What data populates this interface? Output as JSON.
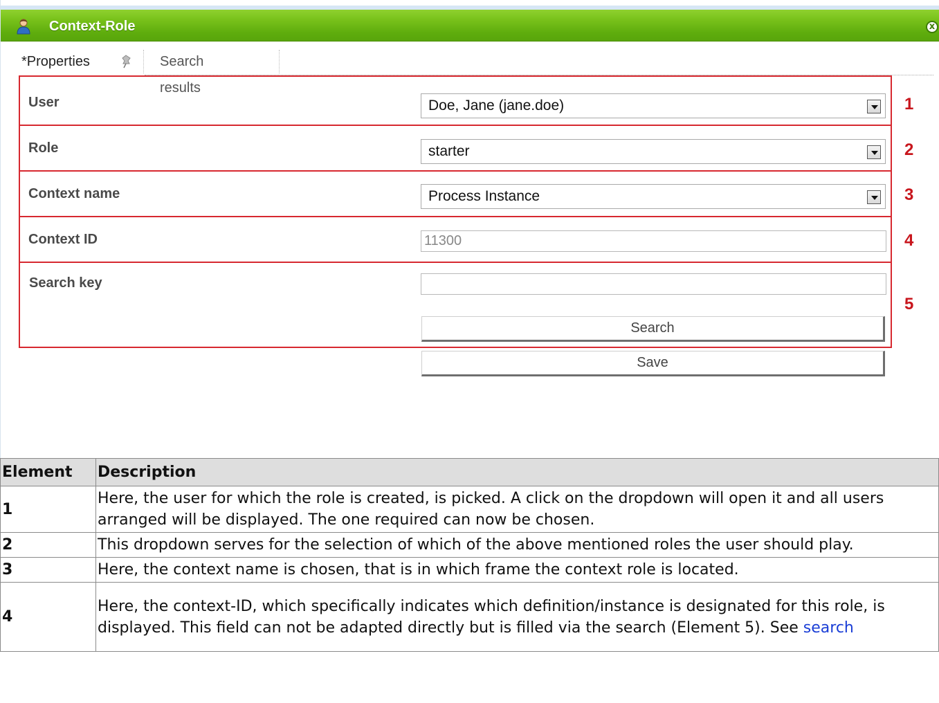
{
  "window": {
    "title": "Context-Role",
    "close_symbol": "x",
    "icon": "user-icon"
  },
  "tabs": [
    {
      "label": "*Properties",
      "icon": "pin-icon",
      "active": true
    },
    {
      "label": "Search results",
      "active": false
    }
  ],
  "form": {
    "user": {
      "label": "User",
      "value": "Doe, Jane (jane.doe)",
      "marker": "1"
    },
    "role": {
      "label": "Role",
      "value": "starter",
      "marker": "2"
    },
    "context_name": {
      "label": "Context name",
      "value": "Process Instance",
      "marker": "3"
    },
    "context_id": {
      "label": "Context ID",
      "value": "11300",
      "marker": "4"
    },
    "search_key": {
      "label": "Search key",
      "value": "",
      "marker": "5"
    },
    "search_button": "Search",
    "save_button": "Save"
  },
  "colors": {
    "titlebar_green": "#6ab814",
    "marker_red": "#c8161d",
    "link_blue": "#1a3ed6"
  },
  "table": {
    "headers": [
      "Element",
      "Description"
    ],
    "rows": [
      {
        "element": "1",
        "description": "Here, the user for which the role is created, is picked. A click on the dropdown will open it and all users arranged will be displayed. The one required can now be chosen."
      },
      {
        "element": "2",
        "description": "This dropdown serves for the selection of which of the above mentioned roles the user should play."
      },
      {
        "element": "3",
        "description": "Here, the context name is chosen, that is in which frame the context role is located."
      },
      {
        "element": "4",
        "description": "Here, the context-ID, which specifically indicates which definition/instance is designated for this role, is displayed. This field can not be adapted directly but is filled via the search (Element 5). See ",
        "link": "search"
      }
    ]
  }
}
